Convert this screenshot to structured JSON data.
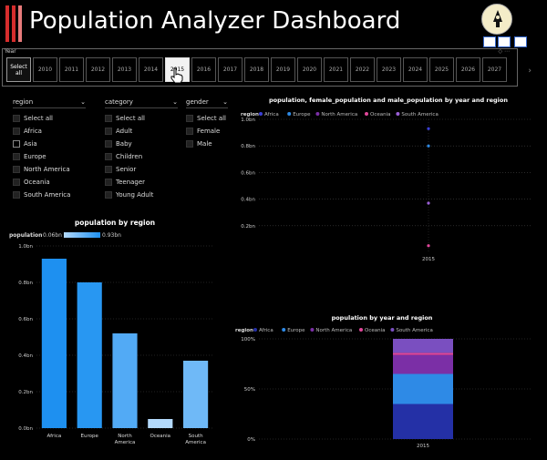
{
  "header": {
    "title": "Population Analyzer Dashboard"
  },
  "year_slicer": {
    "label": "Year",
    "items": [
      "Select all",
      "2010",
      "2011",
      "2012",
      "2013",
      "2014",
      "2015",
      "2016",
      "2017",
      "2018",
      "2019",
      "2020",
      "2021",
      "2022",
      "2023",
      "2024",
      "2025",
      "2026",
      "2027"
    ],
    "active": "2015"
  },
  "filters": {
    "region": {
      "label": "region",
      "items": [
        "Select all",
        "Africa",
        "Asia",
        "Europe",
        "North America",
        "Oceania",
        "South America"
      ]
    },
    "category": {
      "label": "category",
      "items": [
        "Select all",
        "Adult",
        "Baby",
        "Children",
        "Senior",
        "Teenager",
        "Young Adult"
      ]
    },
    "gender": {
      "label": "gender",
      "items": [
        "Select all",
        "Female",
        "Male"
      ]
    }
  },
  "chart_data": [
    {
      "type": "bar",
      "title": "population by region",
      "legend": {
        "label": "population",
        "min_label": "0.06bn",
        "max_label": "0.93bn",
        "placement": "top-left"
      },
      "categories": [
        "Africa",
        "Europe",
        "North America",
        "Oceania",
        "South America"
      ],
      "values": [
        0.93,
        0.8,
        0.52,
        0.05,
        0.37
      ],
      "ylim": [
        0,
        1.0
      ],
      "yticks": [
        "0.0bn",
        "0.2bn",
        "0.4bn",
        "0.6bn",
        "0.8bn",
        "1.0bn"
      ],
      "xlabel": "",
      "ylabel": "",
      "grid": true,
      "colors": [
        "#1e90f0",
        "#2897f2",
        "#52aaf5",
        "#b3d9fb",
        "#6fb9f7"
      ]
    },
    {
      "type": "scatter",
      "title": "population, female_population and male_population by year and region",
      "legend": {
        "label": "region",
        "placement": "top-left"
      },
      "series": [
        {
          "name": "Africa",
          "color": "#3b3fd6"
        },
        {
          "name": "Europe",
          "color": "#2e8ae6"
        },
        {
          "name": "North America",
          "color": "#7b2fa6"
        },
        {
          "name": "Oceania",
          "color": "#e0479a"
        },
        {
          "name": "South America",
          "color": "#9a5fd6"
        }
      ],
      "x": [
        "2015"
      ],
      "points": [
        {
          "series": "Africa",
          "x": "2015",
          "y": 0.93
        },
        {
          "series": "Europe",
          "x": "2015",
          "y": 0.8
        },
        {
          "series": "South America",
          "x": "2015",
          "y": 0.37
        },
        {
          "series": "Oceania",
          "x": "2015",
          "y": 0.05
        }
      ],
      "ylim": [
        0,
        1.0
      ],
      "yticks": [
        "0.2bn",
        "0.4bn",
        "0.6bn",
        "0.8bn",
        "1.0bn"
      ],
      "grid": true
    },
    {
      "type": "bar",
      "stacked": true,
      "title": "population by year and region",
      "legend": {
        "label": "region",
        "placement": "top-left"
      },
      "categories": [
        "2015"
      ],
      "series": [
        {
          "name": "Africa",
          "color": "#2430a6",
          "values": [
            0.35
          ]
        },
        {
          "name": "Europe",
          "color": "#2e8ae6",
          "values": [
            0.3
          ]
        },
        {
          "name": "North America",
          "color": "#7b2fa6",
          "values": [
            0.19
          ]
        },
        {
          "name": "Oceania",
          "color": "#e0479a",
          "values": [
            0.02
          ]
        },
        {
          "name": "South America",
          "color": "#7a4fc0",
          "values": [
            0.14
          ]
        }
      ],
      "ylim": [
        0,
        100
      ],
      "yticks": [
        "0%",
        "50%",
        "100%"
      ],
      "grid": true
    }
  ]
}
